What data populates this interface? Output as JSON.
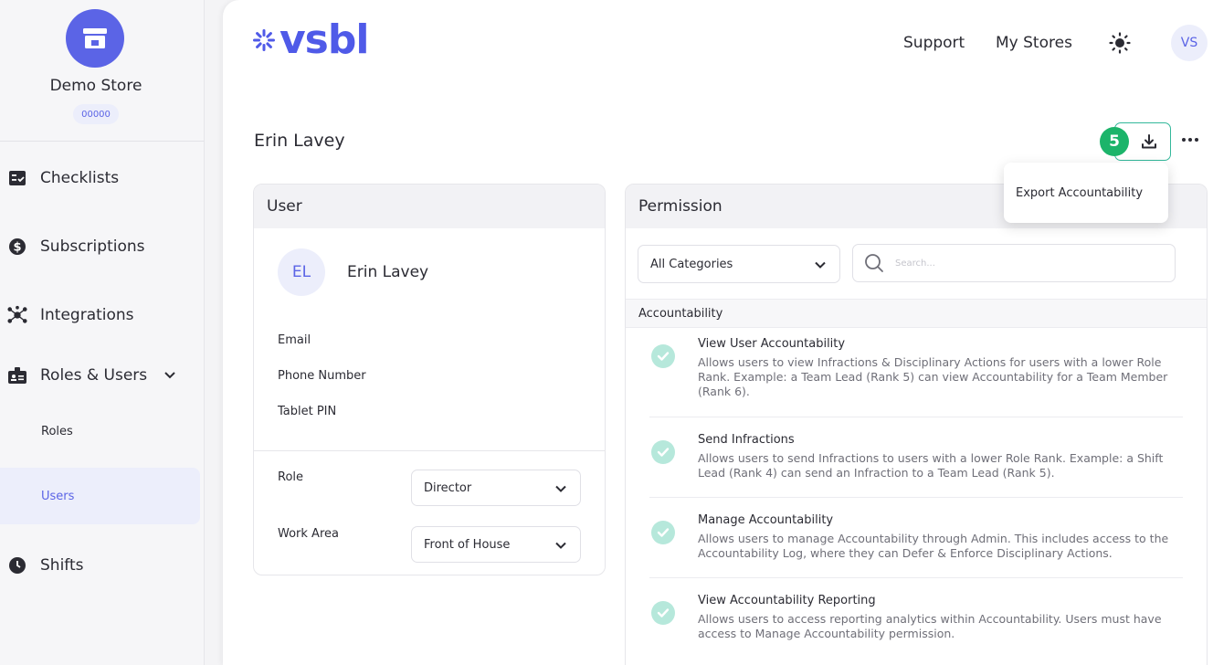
{
  "sidebar": {
    "store_name": "Demo Store",
    "store_code": "00000",
    "items": [
      {
        "label": "Checklists",
        "icon": "checklist-icon"
      },
      {
        "label": "Subscriptions",
        "icon": "dollar-icon"
      },
      {
        "label": "Integrations",
        "icon": "integrations-icon"
      },
      {
        "label": "Roles & Users",
        "icon": "badge-icon"
      },
      {
        "label": "Shifts",
        "icon": "clock-icon"
      }
    ],
    "sub_items": [
      {
        "label": "Roles"
      },
      {
        "label": "Users"
      }
    ],
    "active": "Users"
  },
  "header": {
    "logo_text": "vsbl",
    "links": [
      "Support",
      "My Stores"
    ],
    "avatar_initials": "VS"
  },
  "page": {
    "title": "Erin Lavey",
    "step_badge": "5",
    "menu_item": "Export Accountability"
  },
  "user_card": {
    "header": "User",
    "initials": "EL",
    "name": "Erin Lavey",
    "fields": [
      "Email",
      "Phone Number",
      "Tablet PIN"
    ],
    "role_label": "Role",
    "role_value": "Director",
    "work_area_label": "Work Area",
    "work_area_value": "Front of House"
  },
  "permission_card": {
    "header": "Permission",
    "category_value": "All Categories",
    "search_placeholder": "Search...",
    "section": "Accountability",
    "items": [
      {
        "title": "View User Accountability",
        "desc": "Allows users to view Infractions & Disciplinary Actions for users with a lower Role Rank. Example: a Team Lead (Rank 5) can view Accountability for a Team Member (Rank 6)."
      },
      {
        "title": "Send Infractions",
        "desc": "Allows users to send Infractions to users with a lower Role Rank. Example: a Shift Lead (Rank 4) can send an Infraction to a Team Lead (Rank 5)."
      },
      {
        "title": "Manage Accountability",
        "desc": "Allows users to manage Accountability through Admin.  This includes access to the Accountability Log, where they can Defer & Enforce Disciplinary Actions."
      },
      {
        "title": "View Accountability Reporting",
        "desc": "Allows users to access reporting analytics within Accountability.  Users must have access to Manage Accountability permission."
      }
    ]
  },
  "colors": {
    "brand": "#4f5ae8",
    "accent_green": "#1cb46a",
    "check_bg": "#b6e8db"
  }
}
